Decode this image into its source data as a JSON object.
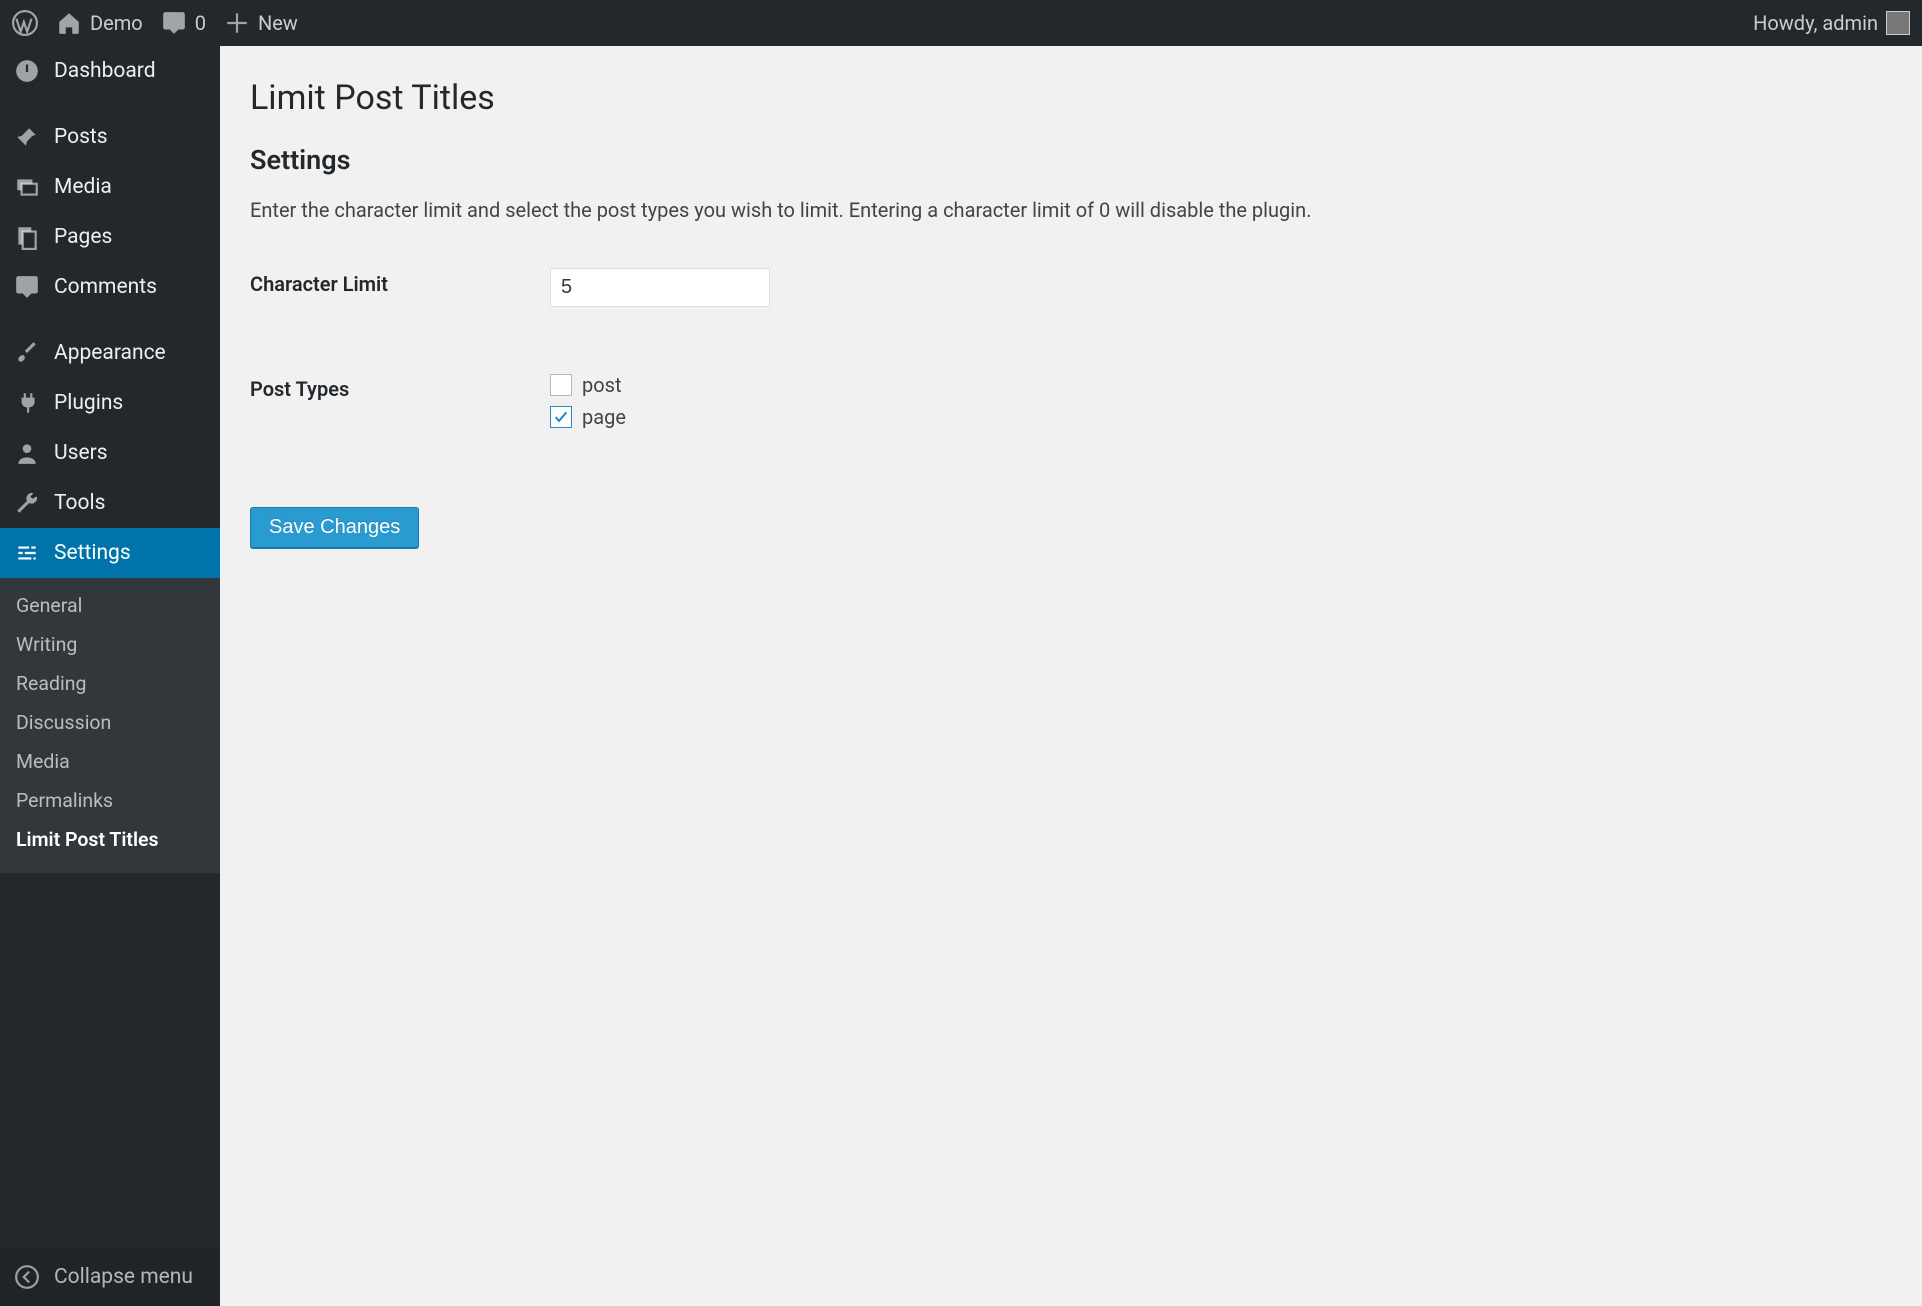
{
  "adminbar": {
    "site_name": "Demo",
    "comments_count": "0",
    "new_label": "New",
    "howdy": "Howdy, admin"
  },
  "sidebar": {
    "items": [
      {
        "label": "Dashboard"
      },
      {
        "label": "Posts"
      },
      {
        "label": "Media"
      },
      {
        "label": "Pages"
      },
      {
        "label": "Comments"
      },
      {
        "label": "Appearance"
      },
      {
        "label": "Plugins"
      },
      {
        "label": "Users"
      },
      {
        "label": "Tools"
      },
      {
        "label": "Settings"
      }
    ],
    "settings_submenu": [
      {
        "label": "General"
      },
      {
        "label": "Writing"
      },
      {
        "label": "Reading"
      },
      {
        "label": "Discussion"
      },
      {
        "label": "Media"
      },
      {
        "label": "Permalinks"
      },
      {
        "label": "Limit Post Titles"
      }
    ],
    "collapse_label": "Collapse menu"
  },
  "page": {
    "title": "Limit Post Titles",
    "section_heading": "Settings",
    "description": "Enter the character limit and select the post types you wish to limit. Entering a character limit of 0 will disable the plugin.",
    "char_limit_label": "Character Limit",
    "char_limit_value": "5",
    "post_types_label": "Post Types",
    "post_types": [
      {
        "name": "post",
        "checked": false
      },
      {
        "name": "page",
        "checked": true
      }
    ],
    "save_label": "Save Changes"
  }
}
